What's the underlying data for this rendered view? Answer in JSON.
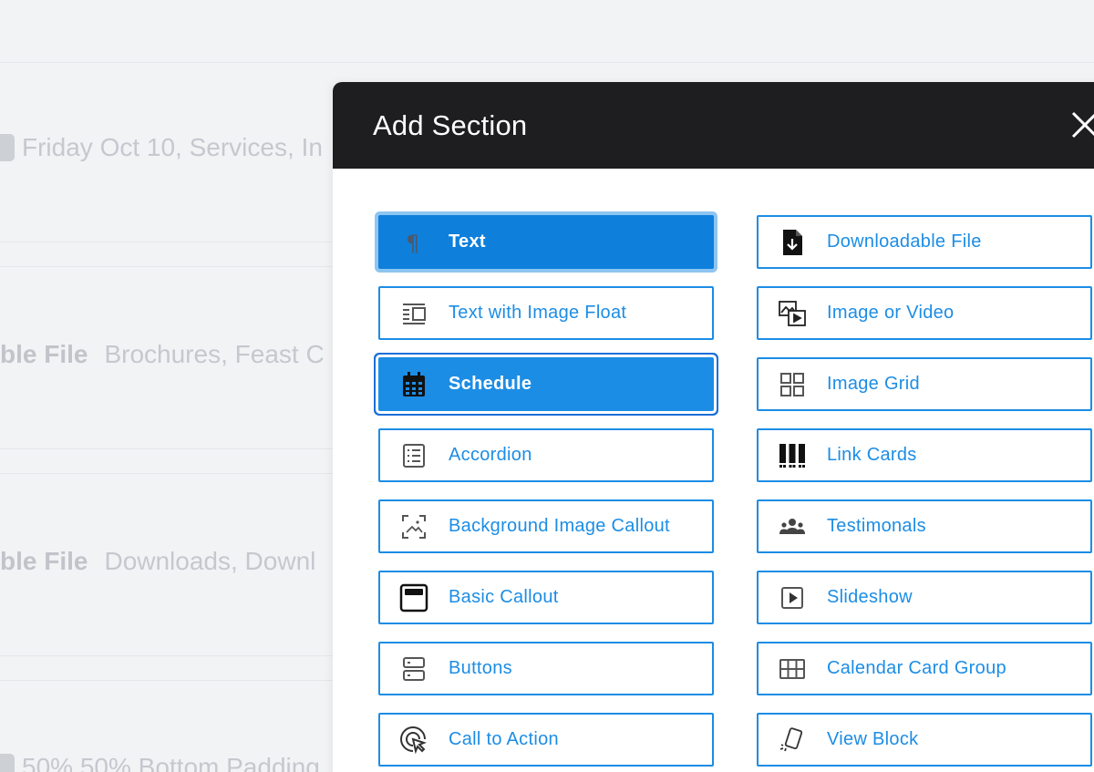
{
  "background": {
    "rows": [
      {
        "prefix": "",
        "strong": "",
        "text": "Friday Oct 10, Services, In"
      },
      {
        "prefix": "",
        "strong": "ble File",
        "text": "Brochures, Feast C"
      },
      {
        "prefix": "",
        "strong": "ble File",
        "text": "Downloads, Downl"
      },
      {
        "prefix": "",
        "strong": "",
        "text": "50%  50%  Bottom Padding"
      }
    ]
  },
  "modal": {
    "title": "Add Section",
    "close_label": "close"
  },
  "sections": {
    "left": [
      {
        "label": "Text",
        "icon": "pilcrow-icon",
        "state": "focused"
      },
      {
        "label": "Text with Image Float",
        "icon": "text-image-float-icon",
        "state": "default"
      },
      {
        "label": "Schedule",
        "icon": "calendar-icon",
        "state": "selected"
      },
      {
        "label": "Accordion",
        "icon": "accordion-icon",
        "state": "default"
      },
      {
        "label": "Background Image Callout",
        "icon": "background-image-icon",
        "state": "default"
      },
      {
        "label": "Basic Callout",
        "icon": "callout-icon",
        "state": "default"
      },
      {
        "label": "Buttons",
        "icon": "buttons-icon",
        "state": "default"
      },
      {
        "label": "Call to Action",
        "icon": "cursor-click-icon",
        "state": "default"
      }
    ],
    "right": [
      {
        "label": "Downloadable File",
        "icon": "file-download-icon",
        "state": "default"
      },
      {
        "label": "Image or Video",
        "icon": "image-video-icon",
        "state": "default"
      },
      {
        "label": "Image Grid",
        "icon": "grid-icon",
        "state": "default"
      },
      {
        "label": "Link Cards",
        "icon": "link-cards-icon",
        "state": "default"
      },
      {
        "label": "Testimonals",
        "icon": "people-icon",
        "state": "default"
      },
      {
        "label": "Slideshow",
        "icon": "play-icon",
        "state": "default"
      },
      {
        "label": "Calendar Card Group",
        "icon": "table-icon",
        "state": "default"
      },
      {
        "label": "View Block",
        "icon": "view-block-icon",
        "state": "default"
      }
    ]
  },
  "colors": {
    "accent": "#1c8de5",
    "header_bg": "#1e1e20",
    "selected_bg": "#0e7fdb"
  }
}
